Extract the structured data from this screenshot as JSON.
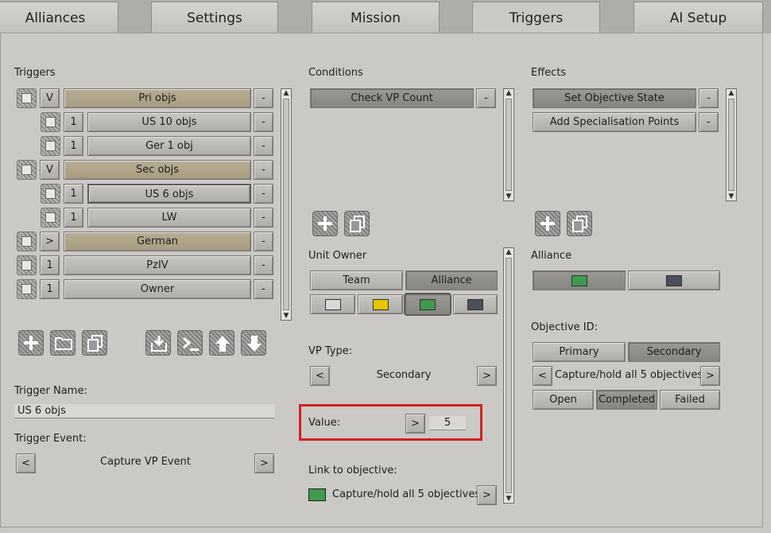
{
  "tabs": [
    {
      "label": "Alliances"
    },
    {
      "label": "Settings"
    },
    {
      "label": "Mission"
    },
    {
      "label": "Triggers"
    },
    {
      "label": "AI Setup"
    }
  ],
  "triggers": {
    "heading": "Triggers",
    "remove_label": "-",
    "rows": [
      {
        "flag": "V",
        "label": "Pri objs"
      },
      {
        "flag": "1",
        "label": "US 10 objs"
      },
      {
        "flag": "1",
        "label": "Ger 1 obj"
      },
      {
        "flag": "V",
        "label": "Sec objs"
      },
      {
        "flag": "1",
        "label": "US 6 objs"
      },
      {
        "flag": "1",
        "label": "LW"
      },
      {
        "flag": ">",
        "label": "German"
      },
      {
        "flag": "1",
        "label": "PzIV"
      },
      {
        "flag": "1",
        "label": "Owner"
      }
    ],
    "trigger_name_label": "Trigger Name:",
    "trigger_name_value": "US 6 objs",
    "trigger_event_label": "Trigger Event:",
    "trigger_event_value": "Capture VP Event",
    "prev": "<",
    "next": ">"
  },
  "conditions": {
    "heading": "Conditions",
    "items": [
      {
        "label": "Check VP Count"
      }
    ],
    "remove_label": "-",
    "unit_owner_label": "Unit Owner",
    "team_label": "Team",
    "alliance_label": "Alliance",
    "colors": [
      "#d8d8d8",
      "#e8c400",
      "#3f9a4f",
      "#4a5058"
    ],
    "vp_type_label": "VP Type:",
    "vp_type_value": "Secondary",
    "value_label": "Value:",
    "value": "5",
    "link_label": "Link to objective:",
    "link_value": "Capture/hold all 5 objectives",
    "link_color": "#3f9a4f",
    "prev": "<",
    "next": ">"
  },
  "effects": {
    "heading": "Effects",
    "items": [
      {
        "label": "Set Objective State"
      },
      {
        "label": "Add Specialisation Points"
      }
    ],
    "remove_label": "-",
    "alliance_label": "Alliance",
    "alliance_colors": [
      "#3f9a4f",
      "#4a5058"
    ],
    "objective_id_label": "Objective ID:",
    "primary_label": "Primary",
    "secondary_label": "Secondary",
    "objective_value": "Capture/hold all 5 objectives",
    "open_label": "Open",
    "completed_label": "Completed",
    "failed_label": "Failed",
    "prev": "<",
    "next": ">"
  },
  "icons": [
    "add-icon",
    "folder-icon",
    "copy-icon",
    "import-icon",
    "console-icon",
    "move-up-icon",
    "move-down-icon"
  ]
}
